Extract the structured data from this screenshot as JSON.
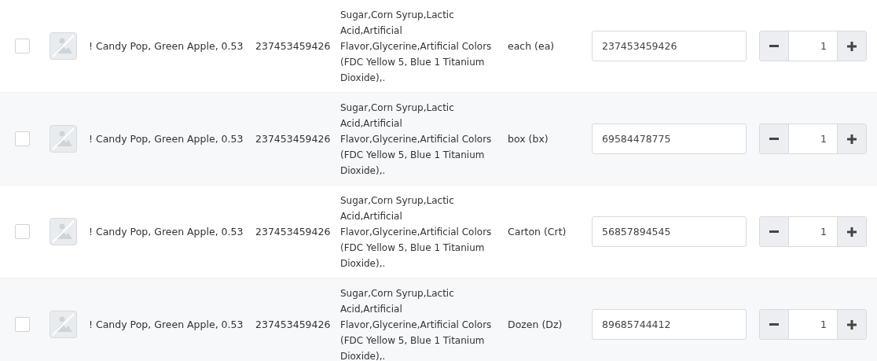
{
  "rows": [
    {
      "checked": false,
      "name": "! Candy Pop, Green Apple, 0.53",
      "code": "237453459426",
      "description": "Sugar,Corn Syrup,Lactic Acid,Artificial Flavor,Glycerine,Artificial Colors (FDC Yellow 5, Blue 1 Titanium Dioxide),.",
      "unit": "each (ea)",
      "barcode": "237453459426",
      "quantity": "1"
    },
    {
      "checked": false,
      "name": "! Candy Pop, Green Apple, 0.53",
      "code": "237453459426",
      "description": "Sugar,Corn Syrup,Lactic Acid,Artificial Flavor,Glycerine,Artificial Colors (FDC Yellow 5, Blue 1 Titanium Dioxide),.",
      "unit": "box (bx)",
      "barcode": "69584478775",
      "quantity": "1"
    },
    {
      "checked": false,
      "name": "! Candy Pop, Green Apple, 0.53",
      "code": "237453459426",
      "description": "Sugar,Corn Syrup,Lactic Acid,Artificial Flavor,Glycerine,Artificial Colors (FDC Yellow 5, Blue 1 Titanium Dioxide),.",
      "unit": "Carton (Crt)",
      "barcode": "56857894545",
      "quantity": "1"
    },
    {
      "checked": false,
      "name": "! Candy Pop, Green Apple, 0.53",
      "code": "237453459426",
      "description": "Sugar,Corn Syrup,Lactic Acid,Artificial Flavor,Glycerine,Artificial Colors (FDC Yellow 5, Blue 1 Titanium Dioxide),.",
      "unit": "Dozen (Dz)",
      "barcode": "89685744412",
      "quantity": "1"
    }
  ]
}
